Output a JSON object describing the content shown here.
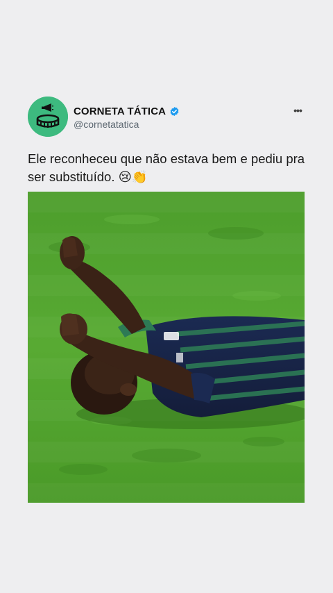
{
  "post": {
    "author": {
      "display_name": "CORNETA TÁTICA",
      "handle": "@cornetatatica",
      "verified": true,
      "avatar_icon": "stadium-megaphone-logo-icon"
    },
    "more_icon": "more-dots-icon",
    "more_label": "•••",
    "text": "Ele reconheceu que não estava bem e pediu pra ser substituído. 😢👏",
    "media": {
      "type": "image",
      "description_icon": "player-lying-on-grass-photo"
    }
  },
  "colors": {
    "background": "#eeeef0",
    "avatar_bg": "#3dba7f",
    "verified_badge": "#1d9bf0",
    "text": "#1a1a1a",
    "handle": "#5b6670",
    "grass": "#4fa12e"
  }
}
